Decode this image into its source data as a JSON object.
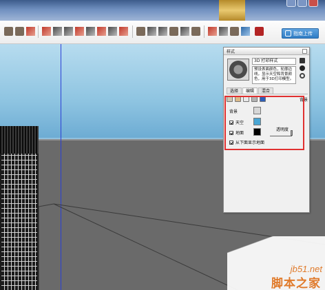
{
  "toolbar": {
    "upload_label": "指南上传"
  },
  "panel": {
    "title": "样式",
    "style_name": "3D 打印样式",
    "style_description": "预设表面颜色，轮廓边线，显示天空和背景颜色，用于3D打印模型。",
    "tabs": [
      {
        "label": "选择"
      },
      {
        "label": "编辑"
      },
      {
        "label": "混合"
      }
    ],
    "section_label": "背景",
    "background": {
      "label": "背景",
      "color": "#d7d7d7"
    },
    "sky": {
      "label": "天空",
      "checked": true,
      "color": "#4aa6d4"
    },
    "ground": {
      "label": "地面",
      "checked": true,
      "color": "#000000",
      "transparency_label": "透明度"
    },
    "show_ground_below": {
      "label": "从下面显示地面",
      "checked": true
    }
  },
  "watermark": {
    "site": "jb51.net",
    "name": "脚本之家"
  },
  "colors": {
    "highlight": "#e03030",
    "axis_blue": "#2a3fd6",
    "sky_top": "#b7dcef",
    "ground": "#6a6a6a"
  }
}
